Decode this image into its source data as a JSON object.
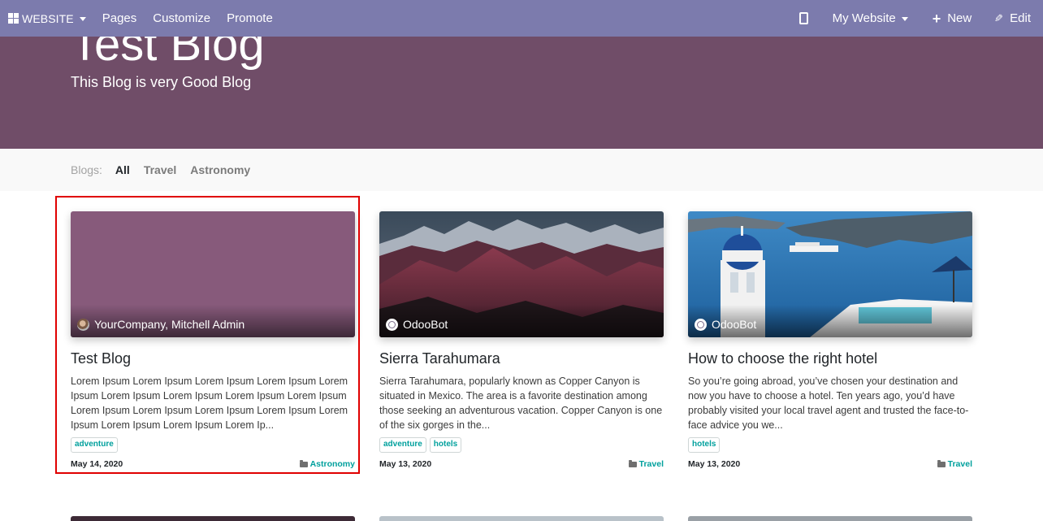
{
  "editor_bar": {
    "website_menu": "WEBSITE",
    "pages": "Pages",
    "customize": "Customize",
    "promote": "Promote",
    "website_selector": "My Website",
    "new_label": "New",
    "edit_label": "Edit"
  },
  "header": {
    "title": "Test Blog",
    "subtitle": "This Blog is very Good Blog",
    "background_color": "#704d68"
  },
  "blog_filter": {
    "label": "Blogs:",
    "items": [
      {
        "label": "All",
        "active": true
      },
      {
        "label": "Travel",
        "active": false
      },
      {
        "label": "Astronomy",
        "active": false
      }
    ]
  },
  "posts": [
    {
      "author": "YourCompany, Mitchell Admin",
      "title": "Test Blog",
      "teaser": "Lorem Ipsum Lorem Ipsum Lorem Ipsum Lorem Ipsum Lorem Ipsum Lorem Ipsum Lorem Ipsum Lorem Ipsum Lorem Ipsum Lorem Ipsum Lorem Ipsum Lorem Ipsum Lorem Ipsum Lorem Ipsum Lorem Ipsum Lorem Ipsum Lorem Ip...",
      "tags": [
        "adventure"
      ],
      "date": "May 14, 2020",
      "category": "Astronomy",
      "cover_color": "#875a7b",
      "highlighted": true
    },
    {
      "author": "OdooBot",
      "title": "Sierra Tarahumara",
      "teaser": "Sierra Tarahumara, popularly known as Copper Canyon is situated in Mexico. The area is a favorite destination among those seeking an adventurous vacation. Copper Canyon is one of the six gorges in the...",
      "tags": [
        "adventure",
        "hotels"
      ],
      "date": "May 13, 2020",
      "category": "Travel",
      "cover_color": "#3b2c3a"
    },
    {
      "author": "OdooBot",
      "title": "How to choose the right hotel",
      "teaser": "So you’re going abroad, you’ve chosen your destination and now you have to choose a hotel. Ten years ago, you’d have probably visited your local travel agent and trusted the face-to-face advice you we...",
      "tags": [
        "hotels"
      ],
      "date": "May 13, 2020",
      "category": "Travel",
      "cover_color": "#2f77b5"
    }
  ],
  "colors": {
    "editor_bar": "#7c7bad",
    "accent": "#00a09d",
    "highlight_border": "#e00000"
  }
}
